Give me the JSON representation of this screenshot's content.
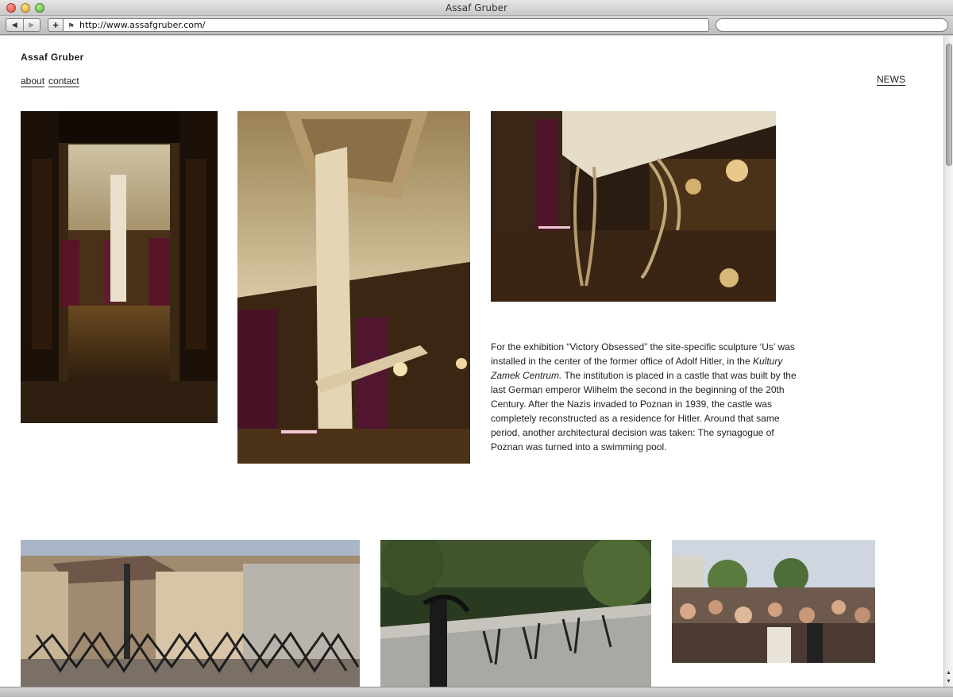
{
  "window": {
    "title": "Assaf Gruber"
  },
  "toolbar": {
    "back": "◀",
    "forward": "▶",
    "add": "+",
    "url": "http://www.assafgruber.com/",
    "search_value": ""
  },
  "site": {
    "title": "Assaf Gruber"
  },
  "nav": {
    "about": "about",
    "contact": "contact",
    "news": "NEWS"
  },
  "caption": {
    "part1": "For the exhibition “Victory Obsessed” the site-specific sculpture ‘Us’ was installed in the center of the former office of Adolf Hitler, in the ",
    "italic": "Kultury Zamek Centrum.",
    "part2": " The institution is placed in a castle that was built by the last German emperor Wilhelm the second in the beginning of the 20th Century. After the Nazis invaded to Poznan in 1939, the castle was completely reconstructed as a residence for Hitler. Around that same period, another architectural decision was taken: The synagogue of Poznan was turned into a swimming pool."
  },
  "icons": {
    "favicon": "signpost-icon"
  }
}
